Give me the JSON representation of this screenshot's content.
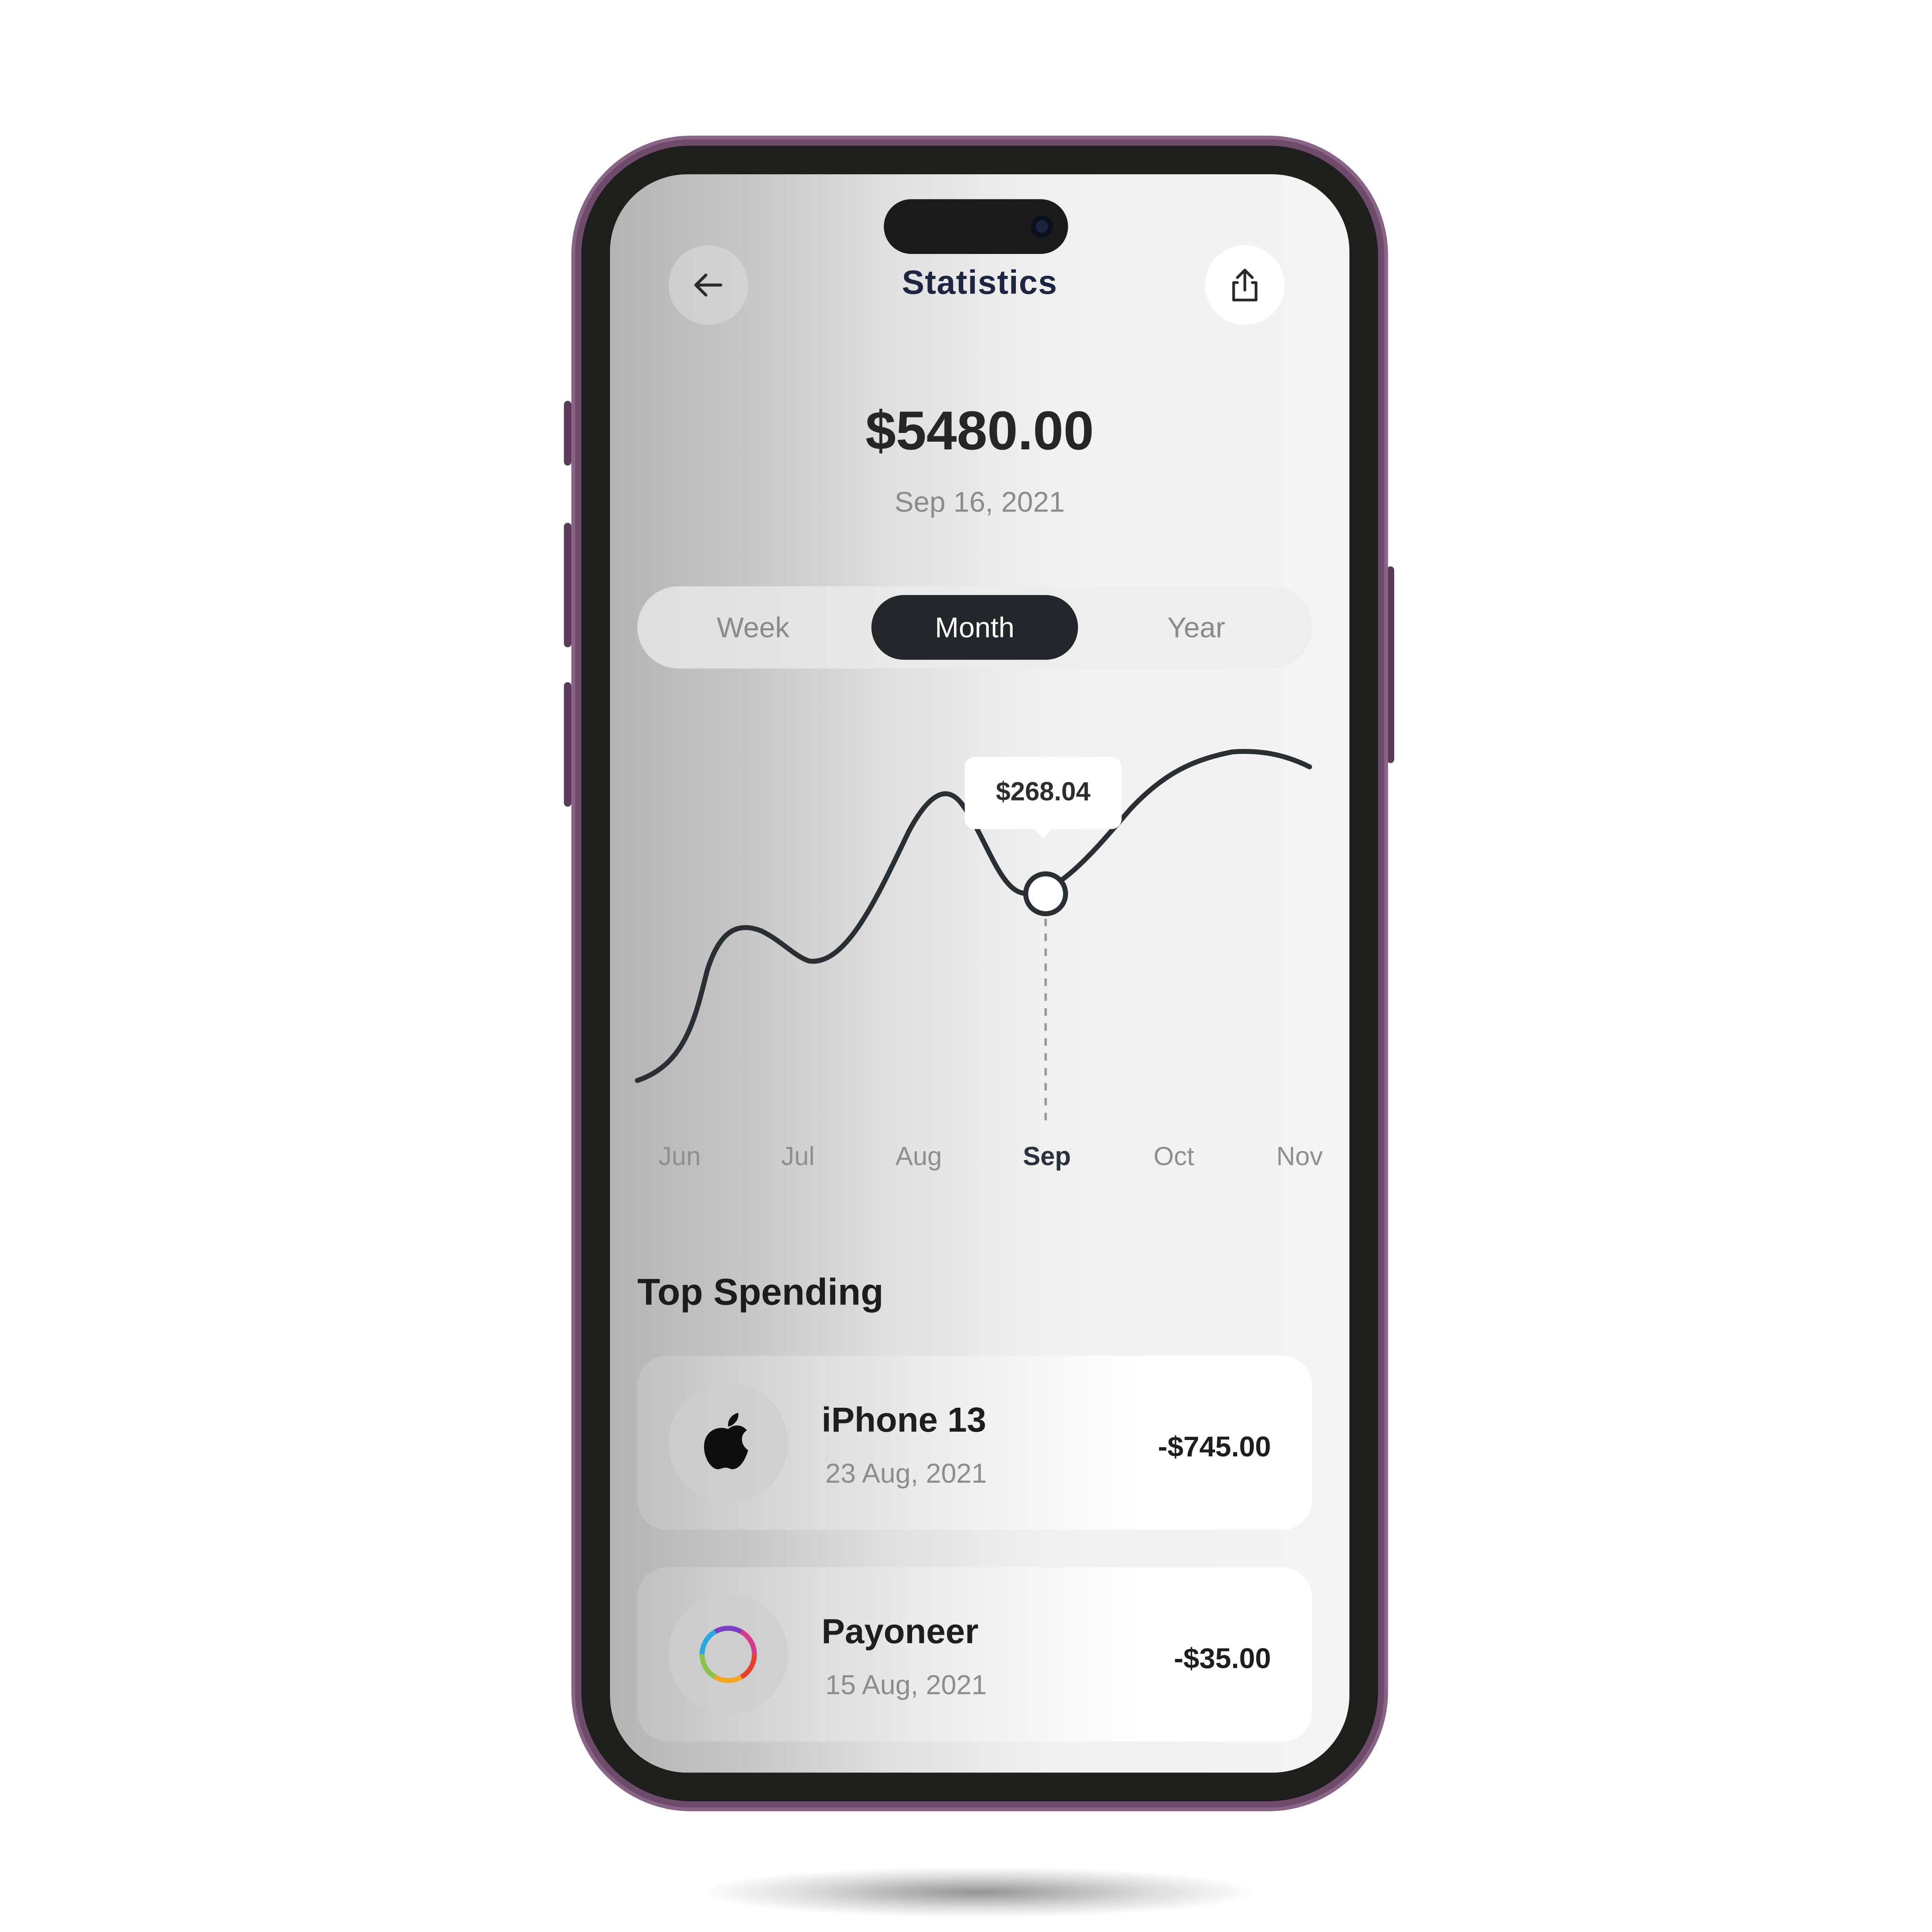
{
  "header": {
    "title": "Statistics",
    "back_icon": "arrow-left-icon",
    "share_icon": "share-icon"
  },
  "summary": {
    "balance": "$5480.00",
    "date": "Sep 16, 2021"
  },
  "period_tabs": {
    "items": [
      {
        "label": "Week"
      },
      {
        "label": "Month"
      },
      {
        "label": "Year"
      }
    ],
    "selected": "Month"
  },
  "chart_data": {
    "type": "line",
    "categories": [
      "Jun",
      "Jul",
      "Aug",
      "Sep",
      "Oct",
      "Nov"
    ],
    "highlighted_category": "Sep",
    "tooltip_value": "$268.04",
    "line_color": "#2b2e33"
  },
  "top_spending": {
    "title": "Top Spending",
    "items": [
      {
        "name": "iPhone 13",
        "date": "23 Aug, 2021",
        "amount": "-$745.00",
        "icon": "apple-logo-icon"
      },
      {
        "name": "Payoneer",
        "date": "15 Aug, 2021",
        "amount": "-$35.00",
        "icon": "payoneer-ring-icon"
      }
    ]
  },
  "colors": {
    "phone_frame": "#6e4a6b",
    "accent_dark": "#24262a",
    "title_navy": "#1d2540"
  }
}
